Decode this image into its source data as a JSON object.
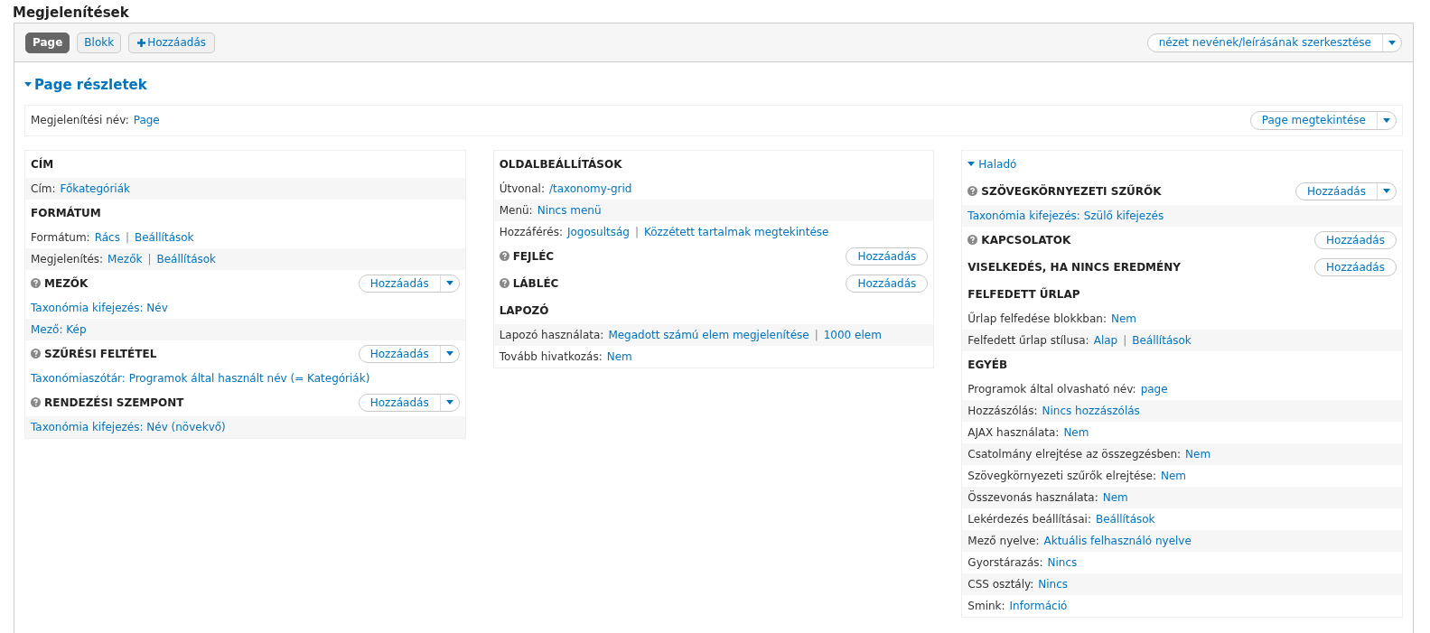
{
  "title": "Megjelenítések",
  "separator": "|",
  "tabs": [
    {
      "label": "Page",
      "kind": "tab",
      "selected": true
    },
    {
      "label": "Blokk",
      "kind": "tab",
      "selected": false
    },
    {
      "label": "Hozzáadás",
      "kind": "add",
      "selected": false
    }
  ],
  "edit_button": {
    "label": "nézet nevének/leírásának szerkesztése",
    "dropdown": true
  },
  "details": {
    "title": "Page részletek",
    "expanded": true,
    "display_name": {
      "label": "Megjelenítési név:",
      "value": "Page"
    },
    "view_button": {
      "label": "Page megtekintése",
      "dropdown": true
    }
  },
  "columns": [
    {
      "first_shaded": true,
      "sections": [
        {
          "title": "CÍM",
          "help": false,
          "rows": [
            {
              "label": "Cím:",
              "links": [
                "Főkategóriák"
              ]
            }
          ]
        },
        {
          "title": "FORMÁTUM",
          "help": false,
          "rows": [
            {
              "label": "Formátum:",
              "links": [
                "Rács",
                "Beállítások"
              ]
            },
            {
              "label": "Megjelenítés:",
              "links": [
                "Mezők",
                "Beállítások"
              ]
            }
          ]
        },
        {
          "title": "MEZŐK",
          "help": true,
          "button": {
            "label": "Hozzáadás",
            "dropdown": true
          },
          "rows": [
            {
              "links": [
                "Taxonómia kifejezés: Név"
              ]
            },
            {
              "links": [
                "Mező: Kép"
              ]
            }
          ]
        },
        {
          "title": "SZŰRÉSI FELTÉTEL",
          "help": true,
          "button": {
            "label": "Hozzáadás",
            "dropdown": true
          },
          "rows": [
            {
              "links": [
                "Taxonómiaszótár: Programok által használt név (= Kategóriák)"
              ]
            }
          ]
        },
        {
          "title": "RENDEZÉSI SZEMPONT",
          "help": true,
          "button": {
            "label": "Hozzáadás",
            "dropdown": true
          },
          "rows": [
            {
              "links": [
                "Taxonómia kifejezés: Név (növekvő)"
              ]
            }
          ]
        }
      ]
    },
    {
      "first_shaded": false,
      "sections": [
        {
          "title": "OLDALBEÁLLÍTÁSOK",
          "help": false,
          "rows": [
            {
              "label": "Útvonal:",
              "links": [
                "/taxonomy-grid"
              ]
            },
            {
              "label": "Menü:",
              "links": [
                "Nincs menü"
              ]
            },
            {
              "label": "Hozzáférés:",
              "links": [
                "Jogosultság",
                "Közzétett tartalmak megtekintése"
              ]
            }
          ]
        },
        {
          "title": "FEJLÉC",
          "help": true,
          "button": {
            "label": "Hozzáadás",
            "dropdown": false
          }
        },
        {
          "title": "LÁBLÉC",
          "help": true,
          "button": {
            "label": "Hozzáadás",
            "dropdown": false
          }
        },
        {
          "title": "LAPOZÓ",
          "help": false,
          "rows": [
            {
              "label": "Lapozó használata:",
              "links": [
                "Megadott számú elem megjelenítése",
                "1000 elem"
              ]
            },
            {
              "label": "Tovább hivatkozás:",
              "links": [
                "Nem"
              ]
            }
          ]
        }
      ]
    },
    {
      "first_shaded": true,
      "group": {
        "title": "Haladó",
        "expanded": true
      },
      "sections": [
        {
          "title": "SZÖVEGKÖRNYEZETI SZŰRŐK",
          "help": true,
          "button": {
            "label": "Hozzáadás",
            "dropdown": true
          },
          "rows": [
            {
              "links": [
                "Taxonómia kifejezés: Szülő kifejezés"
              ]
            }
          ]
        },
        {
          "title": "KAPCSOLATOK",
          "help": true,
          "button": {
            "label": "Hozzáadás",
            "dropdown": false
          }
        },
        {
          "title": "VISELKEDÉS, HA NINCS EREDMÉNY",
          "help": false,
          "button": {
            "label": "Hozzáadás",
            "dropdown": false
          }
        },
        {
          "title": "FELFEDETT ŰRLAP",
          "help": false,
          "rows": [
            {
              "label": "Űrlap felfedése blokkban:",
              "links": [
                "Nem"
              ]
            },
            {
              "label": "Felfedett űrlap stílusa:",
              "links": [
                "Alap",
                "Beállítások"
              ]
            }
          ]
        },
        {
          "title": "EGYÉB",
          "help": false,
          "rows": [
            {
              "label": "Programok által olvasható név:",
              "links": [
                "page"
              ]
            },
            {
              "label": "Hozzászólás:",
              "links": [
                "Nincs hozzászólás"
              ]
            },
            {
              "label": "AJAX használata:",
              "links": [
                "Nem"
              ]
            },
            {
              "label": "Csatolmány elrejtése az összegzésben:",
              "links": [
                "Nem"
              ]
            },
            {
              "label": "Szövegkörnyezeti szűrők elrejtése:",
              "links": [
                "Nem"
              ]
            },
            {
              "label": "Összevonás használata:",
              "links": [
                "Nem"
              ]
            },
            {
              "label": "Lekérdezés beállításai:",
              "links": [
                "Beállítások"
              ]
            },
            {
              "label": "Mező nyelve:",
              "links": [
                "Aktuális felhasználó nyelve"
              ]
            },
            {
              "label": "Gyorstárazás:",
              "links": [
                "Nincs"
              ]
            },
            {
              "label": "CSS osztály:",
              "links": [
                "Nincs"
              ]
            },
            {
              "label": "Smink:",
              "links": [
                "Információ"
              ]
            }
          ]
        }
      ]
    }
  ]
}
